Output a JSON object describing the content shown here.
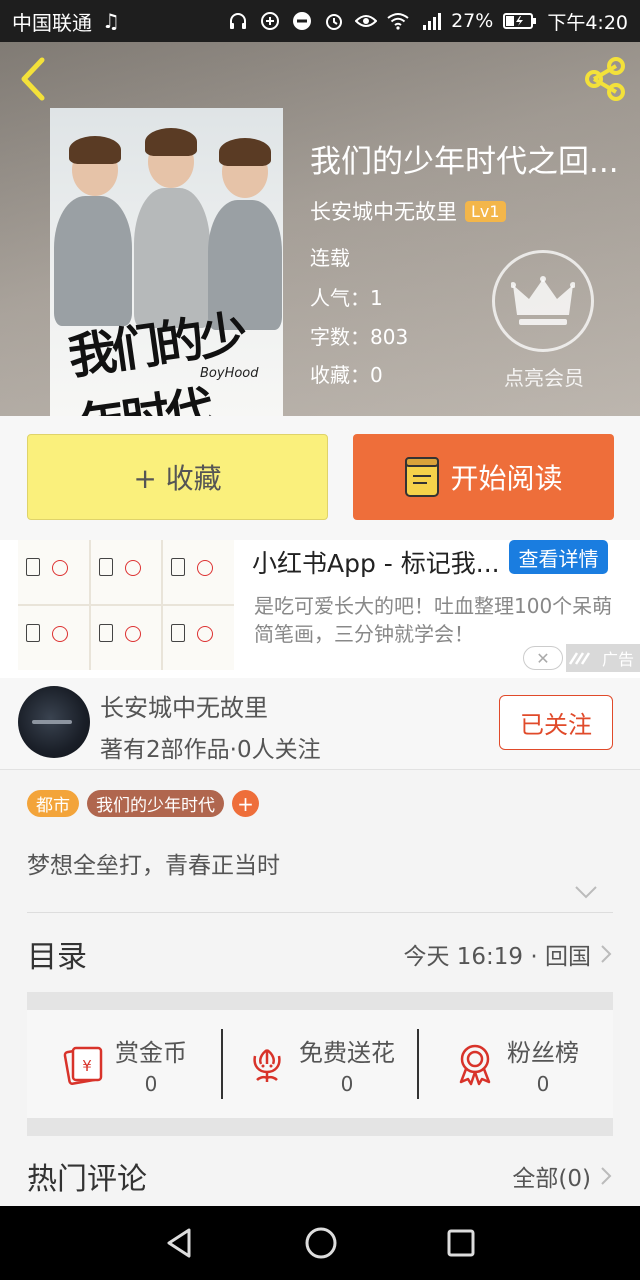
{
  "status_bar": {
    "carrier": "中国联通",
    "battery": "27%",
    "time": "下午4:20"
  },
  "header": {
    "cover_title_text": "我们的少年时代",
    "cover_sub_text": "BoyHood",
    "title": "我们的少年时代之回...",
    "author": "长安城中无故里",
    "level": "Lv1",
    "status": "连载",
    "popularity": "人气：1",
    "word_count": "字数：803",
    "favorites": "收藏：0",
    "vip_label": "点亮会员"
  },
  "actions": {
    "favorite_label": "+ 收藏",
    "read_label": "开始阅读"
  },
  "ad": {
    "title": "小红书App - 标记我...",
    "button": "查看详情",
    "description": "是吃可爱长大的吧！吐血整理100个呆萌简笔画，三分钟就学会！",
    "tag": "广告"
  },
  "author_card": {
    "name": "长安城中无故里",
    "stats": "著有2部作品·0人关注",
    "follow_label": "已关注"
  },
  "tags": [
    {
      "label": "都市",
      "color": "#f3a43a"
    },
    {
      "label": "我们的少年时代",
      "color": "#b0664e"
    }
  ],
  "intro": "梦想全垒打，青春正当时",
  "toc": {
    "title": "目录",
    "update": "今天 16:19 · 回国"
  },
  "rewards": [
    {
      "label": "赏金币",
      "count": "0",
      "icon": "red-envelope-icon"
    },
    {
      "label": "免费送花",
      "count": "0",
      "icon": "flower-icon"
    },
    {
      "label": "粉丝榜",
      "count": "0",
      "icon": "medal-icon"
    }
  ],
  "comments": {
    "title": "热门评论",
    "all_label": "全部(0)"
  },
  "colors": {
    "accent_orange": "#ee6e3a",
    "favorite_yellow": "#faf07c",
    "ad_blue": "#1a7de0",
    "follow_red": "#e04a2a",
    "level_gold": "#f3b64a"
  }
}
